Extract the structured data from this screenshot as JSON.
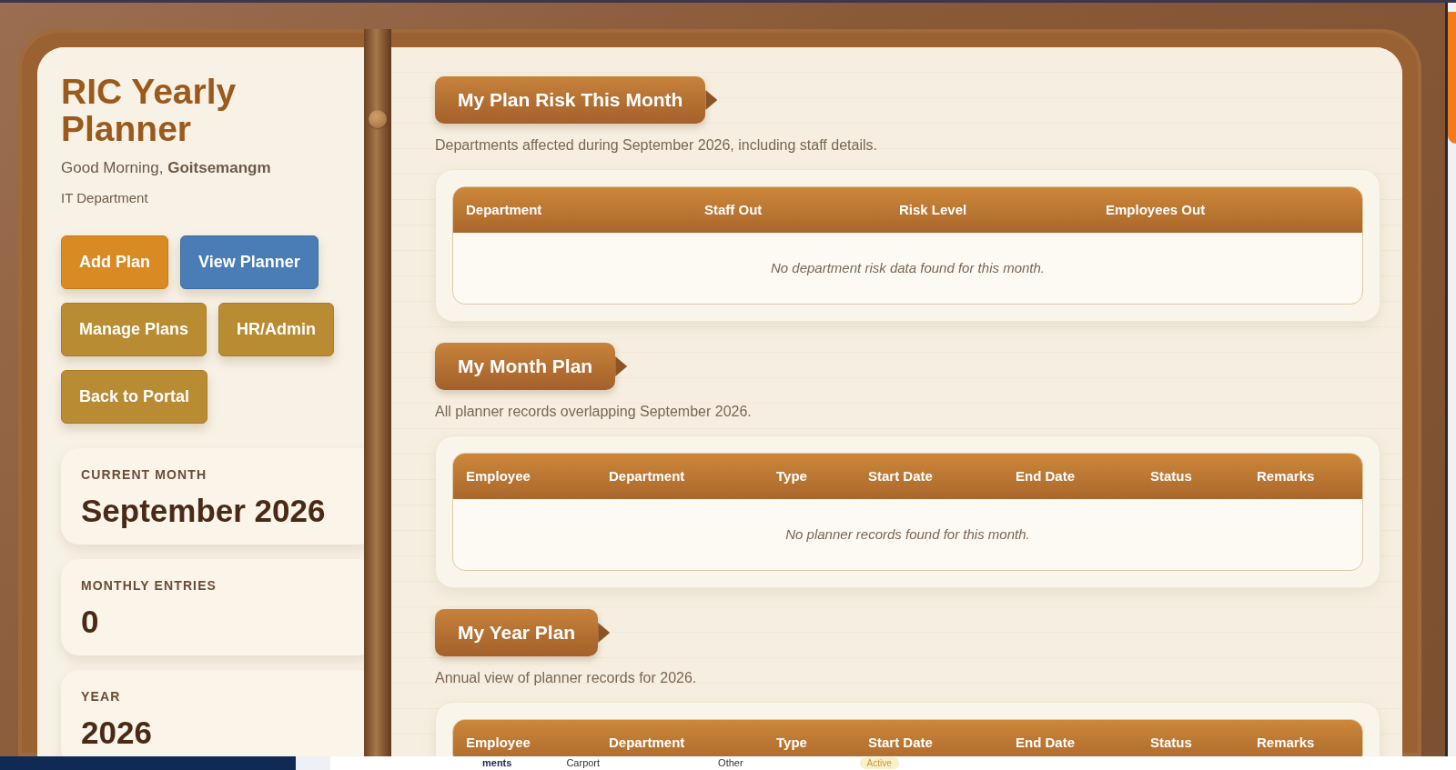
{
  "app": {
    "title": "RIC Yearly Planner",
    "greeting": "Good Morning, **Goitsemangm**",
    "department": "IT Department"
  },
  "actions": [
    {
      "label": "Add Plan",
      "kind": "accent"
    },
    {
      "label": "View Planner",
      "kind": "info"
    },
    {
      "label": "Manage Plans",
      "kind": "default"
    },
    {
      "label": "HR/Admin",
      "kind": "default"
    },
    {
      "label": "Back to Portal",
      "kind": "default"
    }
  ],
  "stats": [
    {
      "label": "CURRENT MONTH",
      "value": "September 2026"
    },
    {
      "label": "MONTHLY ENTRIES",
      "value": "0"
    },
    {
      "label": "YEAR",
      "value": "2026"
    }
  ],
  "sections": [
    {
      "title": "My Plan Risk This Month",
      "subtitle": "Departments affected during September 2026, including staff details.",
      "columns": [
        "Department",
        "Staff Out",
        "Risk Level",
        "Employees Out"
      ],
      "empty_message": "No department risk data found for this month."
    },
    {
      "title": "My Month Plan",
      "subtitle": "All planner records overlapping September 2026.",
      "columns": [
        "Employee",
        "Department",
        "Type",
        "Start Date",
        "End Date",
        "Status",
        "Remarks"
      ],
      "empty_message": "No planner records found for this month."
    },
    {
      "title": "My Year Plan",
      "subtitle": "Annual view of planner records for 2026.",
      "columns": [
        "Employee",
        "Department",
        "Type",
        "Start Date",
        "End Date",
        "Status",
        "Remarks"
      ]
    }
  ],
  "background_window": {
    "cells": [
      "ments",
      "Carport",
      "Other"
    ],
    "badge": "Active"
  }
}
